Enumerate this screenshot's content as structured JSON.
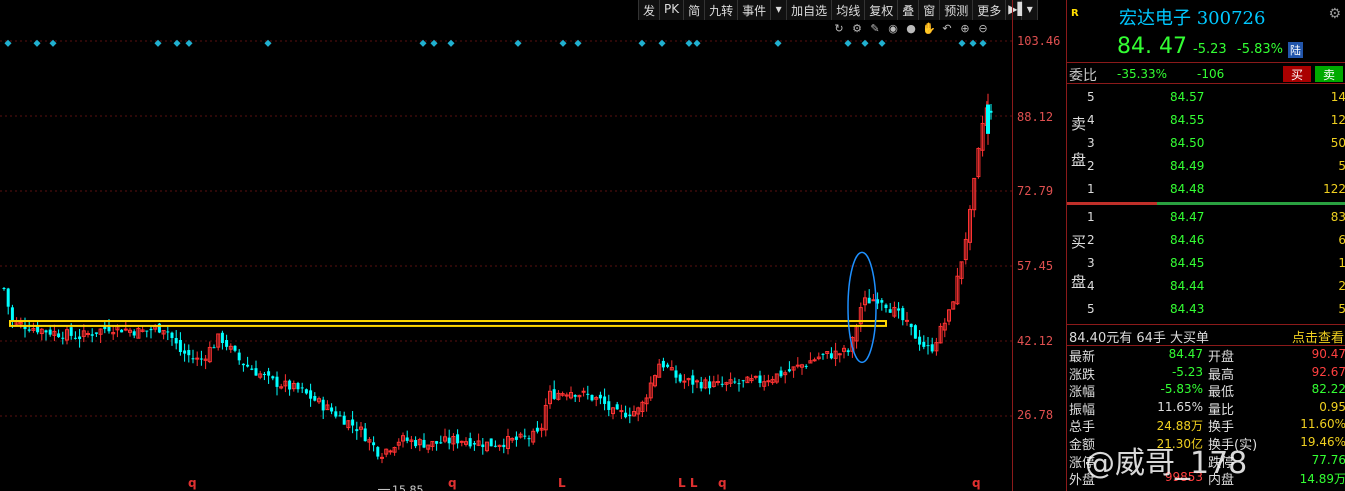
{
  "toolbar": {
    "items": [
      "发",
      "PK",
      "简",
      "九转",
      "事件",
      "加自选",
      "均线",
      "复权",
      "叠",
      "窗",
      "预测",
      "更多"
    ]
  },
  "price_axis": {
    "labels": [
      "103.46",
      "88.12",
      "72.79",
      "57.45",
      "42.12",
      "26.78"
    ]
  },
  "chart": {
    "low_label": "15.85",
    "bottom_markers": [
      "q",
      "q",
      "q",
      "L",
      "L L",
      "q",
      "q"
    ],
    "colors": {
      "up": "#ff3232",
      "down": "#00ffff",
      "support_line": "#ffd700",
      "highlight_ellipse": "#1e90ff"
    }
  },
  "stock": {
    "badge": "R",
    "name": "宏达电子 300726",
    "price": "84. 47",
    "change": "-5.23",
    "change_pct": "-5.83%",
    "market_badge": "陆"
  },
  "order_ratio": {
    "label": "委比",
    "pct": "-35.33%",
    "diff": "-106",
    "buy_label": "买",
    "sell_label": "卖"
  },
  "ask": {
    "side_label": [
      "卖",
      "盘"
    ],
    "levels": [
      {
        "lv": "5",
        "price": "84.57",
        "vol": "14"
      },
      {
        "lv": "4",
        "price": "84.55",
        "vol": "12"
      },
      {
        "lv": "3",
        "price": "84.50",
        "vol": "50"
      },
      {
        "lv": "2",
        "price": "84.49",
        "vol": "5"
      },
      {
        "lv": "1",
        "price": "84.48",
        "vol": "122"
      }
    ]
  },
  "bid": {
    "side_label": [
      "买",
      "盘"
    ],
    "levels": [
      {
        "lv": "1",
        "price": "84.47",
        "vol": "83"
      },
      {
        "lv": "2",
        "price": "84.46",
        "vol": "6"
      },
      {
        "lv": "3",
        "price": "84.45",
        "vol": "1"
      },
      {
        "lv": "4",
        "price": "84.44",
        "vol": "2"
      },
      {
        "lv": "5",
        "price": "84.43",
        "vol": "5"
      }
    ]
  },
  "big_order": {
    "text": "84.40元有 64手 大买单",
    "link": "点击查看"
  },
  "stats": [
    {
      "l": "最新",
      "v": "84.47",
      "vc": "green",
      "l2": "开盘",
      "v2": "90.47",
      "v2c": "red"
    },
    {
      "l": "涨跌",
      "v": "-5.23",
      "vc": "green",
      "l2": "最高",
      "v2": "92.67",
      "v2c": "red"
    },
    {
      "l": "涨幅",
      "v": "-5.83%",
      "vc": "green",
      "l2": "最低",
      "v2": "82.22",
      "v2c": "green"
    },
    {
      "l": "振幅",
      "v": "11.65%",
      "vc": "white",
      "l2": "量比",
      "v2": "0.95",
      "v2c": "yellow"
    },
    {
      "l": "总手",
      "v": "24.88万",
      "vc": "yellow",
      "l2": "换手",
      "v2": "11.60%",
      "v2c": "yellow"
    },
    {
      "l": "金额",
      "v": "21.30亿",
      "vc": "yellow",
      "l2": "换手(实)",
      "v2": "19.46%",
      "v2c": "yellow"
    },
    {
      "l": "涨停",
      "v": "",
      "vc": "red",
      "l2": "跌停",
      "v2": "77.76",
      "v2c": "green"
    },
    {
      "l": "外盘",
      "v": "99853",
      "vc": "red",
      "l2": "内盘",
      "v2": "14.89万",
      "v2c": "green"
    }
  ],
  "watermark": "@威哥_178"
}
